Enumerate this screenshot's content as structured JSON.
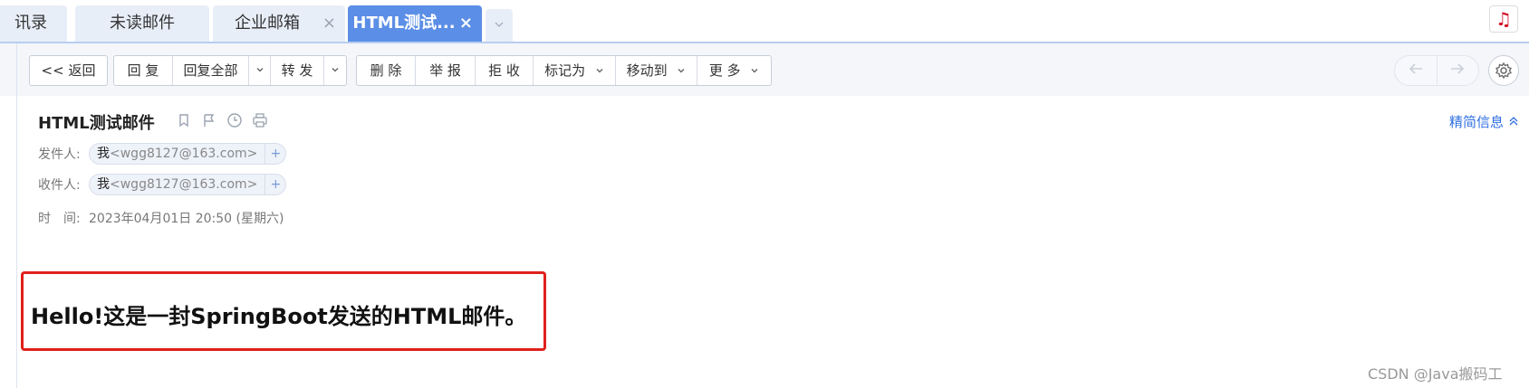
{
  "tabs": [
    {
      "label": "讯录"
    },
    {
      "label": "未读邮件"
    },
    {
      "label": "企业邮箱",
      "close": "×"
    },
    {
      "label": "HTML测试...",
      "close": "×"
    }
  ],
  "tab_more_icon": "chevron-down-icon",
  "toolbar": {
    "back": "<< 返回",
    "reply": "回 复",
    "reply_all": "回复全部",
    "forward": "转 发",
    "delete": "删 除",
    "report": "举 报",
    "reject": "拒 收",
    "mark_as": "标记为",
    "move_to": "移动到",
    "more": "更 多"
  },
  "mail": {
    "subject": "HTML测试邮件",
    "brief_info": "精简信息",
    "from_label": "发件人:",
    "to_label": "收件人:",
    "time_label": "时　间:",
    "from_name": "我",
    "from_email": "<wgg8127@163.com>",
    "to_name": "我",
    "to_email": "<wgg8127@163.com>",
    "time": "2023年04月01日 20:50 (星期六)",
    "body": "Hello!这是一封SpringBoot发送的HTML邮件。"
  },
  "watermark": "CSDN @Java搬码工",
  "colors": {
    "active_tab": "#5b8ee6",
    "link": "#2f6fe0",
    "highlight_border": "#e0201b"
  }
}
